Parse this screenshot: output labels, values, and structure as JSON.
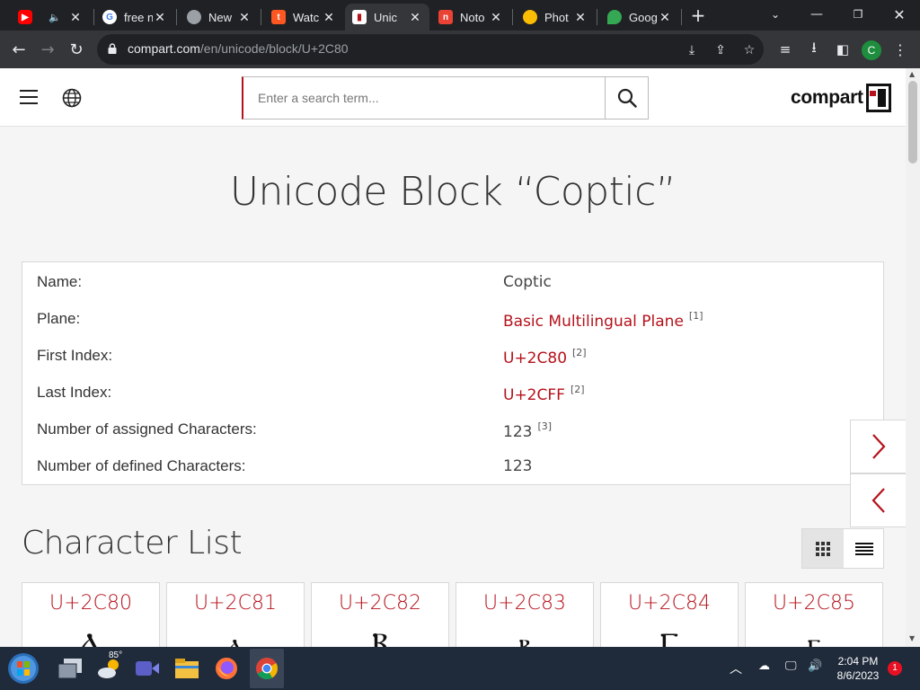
{
  "browser": {
    "tabs": [
      {
        "title": "",
        "favicon": "youtube-icon",
        "color": "#ff0000",
        "audio": true
      },
      {
        "title": "free n",
        "favicon": "google-icon",
        "color": "#4285f4"
      },
      {
        "title": "New",
        "favicon": "chrome-icon",
        "color": "#9aa0a6"
      },
      {
        "title": "Watc",
        "favicon": "t-icon",
        "color": "#ff5722"
      },
      {
        "title": "Unic",
        "favicon": "compart-icon",
        "color": "#b5121b",
        "active": true
      },
      {
        "title": "Noto",
        "favicon": "noto-icon",
        "color": "#ea4335"
      },
      {
        "title": "Phot",
        "favicon": "photos-icon",
        "color": "#fbbc04"
      },
      {
        "title": "Goog",
        "favicon": "maps-icon",
        "color": "#34a853"
      }
    ],
    "url_domain": "compart.com",
    "url_path": "/en/unicode/block/U+2C80",
    "profile_initial": "C"
  },
  "site": {
    "search_placeholder": "Enter a search term...",
    "logo_text": "compart"
  },
  "page": {
    "title": "Unicode Block “Coptic”",
    "info": [
      {
        "label": "Name:",
        "value": "Coptic",
        "link": false,
        "ref": ""
      },
      {
        "label": "Plane:",
        "value": "Basic Multilingual Plane",
        "link": true,
        "ref": "[1]"
      },
      {
        "label": "First Index:",
        "value": "U+2C80",
        "link": true,
        "ref": "[2]"
      },
      {
        "label": "Last Index:",
        "value": "U+2CFF",
        "link": true,
        "ref": "[2]"
      },
      {
        "label": "Number of assigned Characters:",
        "value": "123",
        "link": false,
        "ref": "[3]"
      },
      {
        "label": "Number of defined Characters:",
        "value": "123",
        "link": false,
        "ref": ""
      }
    ],
    "section_title": "Character List",
    "characters": [
      {
        "code": "U+2C80",
        "glyph": "Ⲁ"
      },
      {
        "code": "U+2C81",
        "glyph": "ⲁ"
      },
      {
        "code": "U+2C82",
        "glyph": "Ⲃ"
      },
      {
        "code": "U+2C83",
        "glyph": "ⲃ"
      },
      {
        "code": "U+2C84",
        "glyph": "Ⲅ"
      },
      {
        "code": "U+2C85",
        "glyph": "ⲅ"
      }
    ]
  },
  "taskbar": {
    "weather_temp": "85°",
    "time": "2:04 PM",
    "date": "8/6/2023",
    "notification_count": "1"
  },
  "colors": {
    "accent": "#b5121b",
    "chrome_dark": "#202124",
    "chrome_toolbar": "#35363a"
  }
}
